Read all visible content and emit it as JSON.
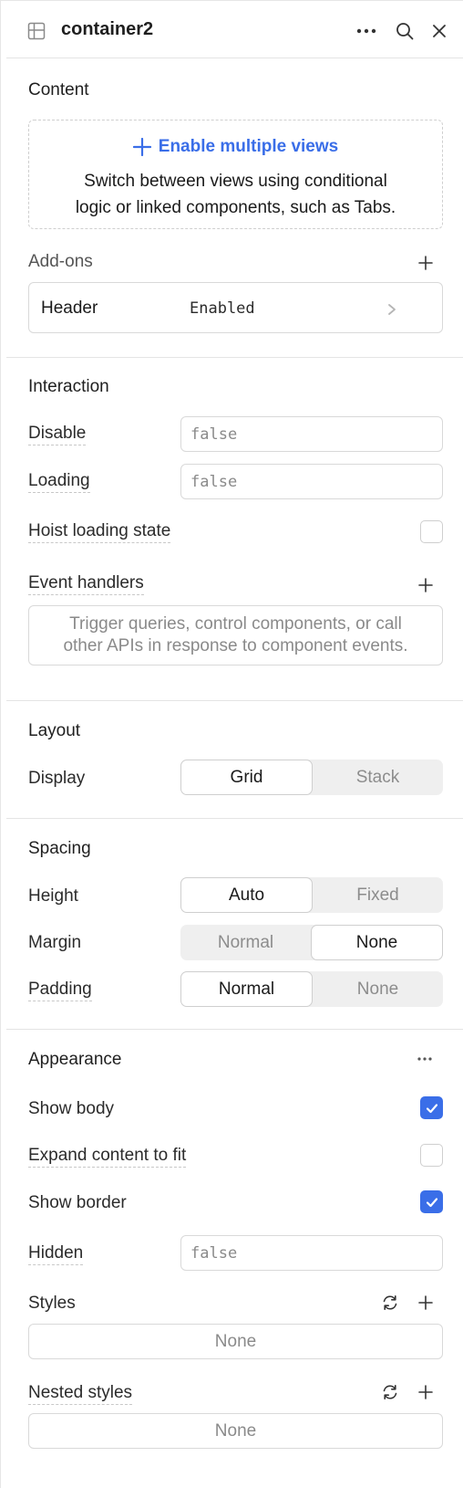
{
  "header": {
    "title": "container2",
    "grid_icon": "grid-icon",
    "more_icon": "more-horizontal-icon",
    "search_icon": "search-icon",
    "close_icon": "close-icon"
  },
  "content": {
    "title": "Content",
    "enable_views_label": "Enable multiple views",
    "enable_views_desc_line1": "Switch between views using conditional",
    "enable_views_desc_line2": "logic or linked components, such as Tabs."
  },
  "addons": {
    "title": "Add-ons",
    "header_row": {
      "label": "Header",
      "value": "Enabled"
    }
  },
  "interaction": {
    "title": "Interaction",
    "disable_label": "Disable",
    "disable_value": "false",
    "loading_label": "Loading",
    "loading_value": "false",
    "hoist_label": "Hoist loading state",
    "hoist_checked": false,
    "event_handlers_label": "Event handlers",
    "event_handlers_hint_line1": "Trigger queries, control components, or call",
    "event_handlers_hint_line2": "other APIs in response to component events."
  },
  "layout": {
    "title": "Layout",
    "display_label": "Display",
    "display_options": [
      "Grid",
      "Stack"
    ],
    "display_selected": "Grid"
  },
  "spacing": {
    "title": "Spacing",
    "height_label": "Height",
    "height_options": [
      "Auto",
      "Fixed"
    ],
    "height_selected": "Auto",
    "margin_label": "Margin",
    "margin_options": [
      "Normal",
      "None"
    ],
    "margin_selected": "None",
    "padding_label": "Padding",
    "padding_options": [
      "Normal",
      "None"
    ],
    "padding_selected": "Normal"
  },
  "appearance": {
    "title": "Appearance",
    "show_body_label": "Show body",
    "show_body_checked": true,
    "expand_label": "Expand content to fit",
    "expand_checked": false,
    "show_border_label": "Show border",
    "show_border_checked": true,
    "hidden_label": "Hidden",
    "hidden_value": "false",
    "styles_label": "Styles",
    "styles_value": "None",
    "nested_styles_label": "Nested styles",
    "nested_styles_value": "None"
  },
  "colors": {
    "accent": "#3a6ee8",
    "text": "#1a1a1a",
    "muted": "#8a8a8a",
    "border": "#d9d9d9"
  }
}
